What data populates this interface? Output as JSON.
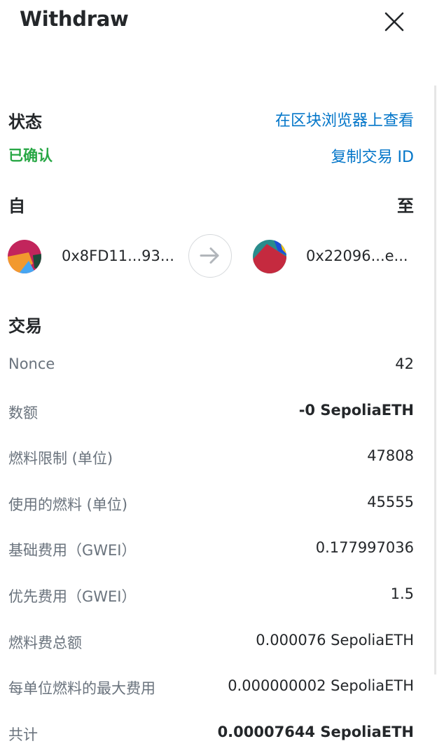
{
  "header": {
    "title": "Withdraw",
    "close_icon": "close-icon"
  },
  "status": {
    "label": "状态",
    "value": "已确认",
    "value_color": "#28a745",
    "view_explorer_link": "在区块浏览器上查看",
    "copy_tx_id_link": "复制交易 ID",
    "link_color": "#0376c9"
  },
  "parties": {
    "from_label": "自",
    "to_label": "至",
    "from_address": "0x8FD11...93...",
    "to_address": "0x22096...e...",
    "arrow_icon": "arrow-right-icon"
  },
  "transaction": {
    "section_title": "交易",
    "rows": [
      {
        "label": "Nonce",
        "value": "42"
      },
      {
        "label": "数额",
        "value": "-0 SepoliaETH"
      },
      {
        "label": "燃料限制 (单位)",
        "value": "47808"
      },
      {
        "label": "使用的燃料 (单位)",
        "value": "45555"
      },
      {
        "label": "基础费用（GWEI）",
        "value": "0.177997036"
      },
      {
        "label": "优先费用（GWEI）",
        "value": "1.5"
      },
      {
        "label": "燃料费总额",
        "value": "0.000076 SepoliaETH"
      },
      {
        "label": "每单位燃料的最大费用",
        "value": "0.000000002 SepoliaETH"
      },
      {
        "label": "共计",
        "value": "0.00007644 SepoliaETH"
      }
    ]
  }
}
